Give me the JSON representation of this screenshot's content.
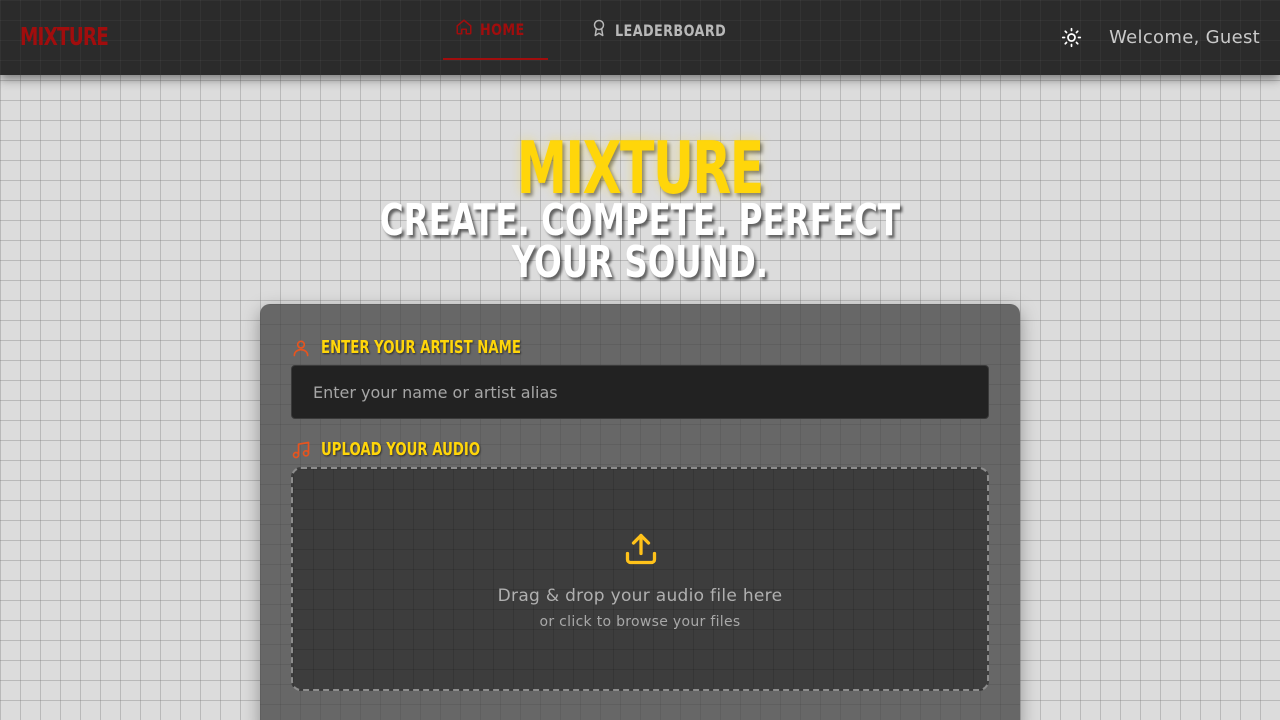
{
  "navbar": {
    "brand": "MIXTURE",
    "links": [
      {
        "label": "HOME",
        "icon": "home-icon",
        "active": true
      },
      {
        "label": "LEADERBOARD",
        "icon": "award-icon",
        "active": false
      }
    ],
    "theme_icon": "sun-icon",
    "welcome": "Welcome, Guest"
  },
  "hero": {
    "title": "MIXTURE",
    "tagline": "CREATE. COMPETE. PERFECT YOUR SOUND."
  },
  "form": {
    "name_label": "ENTER YOUR ARTIST NAME",
    "name_placeholder": "Enter your name or artist alias",
    "name_value": "",
    "audio_label": "UPLOAD YOUR AUDIO",
    "dropzone_title": "Drag & drop your audio file here",
    "dropzone_subtitle": "or click to browse your files"
  },
  "colors": {
    "brand_red": "#a10d0d",
    "accent_yellow": "#ffd60a",
    "icon_orange": "#e8541e",
    "navbar_bg": "#2b2b2b"
  }
}
